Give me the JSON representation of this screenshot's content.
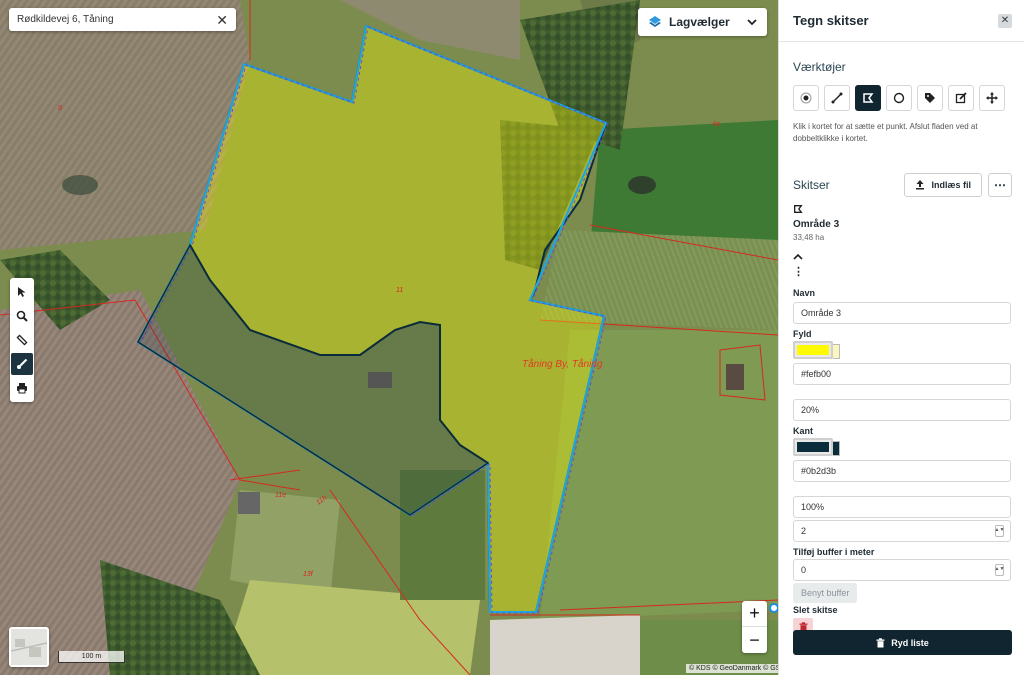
{
  "search": {
    "value": "Rødkildevej 6, Tåning"
  },
  "layer_picker": {
    "label": "Lagvælger"
  },
  "map": {
    "label_place": "Tåning By, Tåning",
    "label_11": "11",
    "label_11e": "11e",
    "label_13f": "13f",
    "label_8": "8",
    "label_4a": "4a",
    "label_1": "1",
    "label_road": "11h",
    "scale": "100 m",
    "attribution": "© KDS © GeoDanmark © GST",
    "zoom_in": "+",
    "zoom_out": "−"
  },
  "panel": {
    "title": "Tegn skitser",
    "close": "✕",
    "tools_title": "Værktøjer",
    "hint": "Klik i kortet for at sætte et punkt. Afslut fladen ved at dobbeltklikke i kortet.",
    "sketches_title": "Skitser",
    "import_label": "Indlæs fil",
    "more_label": "⋯",
    "item": {
      "name": "Område 3",
      "area": "33,48 ha",
      "name_label": "Navn",
      "name_value": "Område 3",
      "fill_label": "Fyld",
      "fill_color": "#fefb00",
      "fill_hex": "#fefb00",
      "fill_opacity": "20%",
      "stroke_label": "Kant",
      "stroke_color": "#0b2d3b",
      "stroke_hex": "#0b2d3b",
      "stroke_opacity": "100%",
      "stroke_width": "2",
      "buffer_label": "Tilføj buffer i meter",
      "buffer_value": "0",
      "apply_buffer": "Benyt buffer",
      "delete_label": "Slet skitse"
    },
    "clear_label": "Ryd liste"
  }
}
